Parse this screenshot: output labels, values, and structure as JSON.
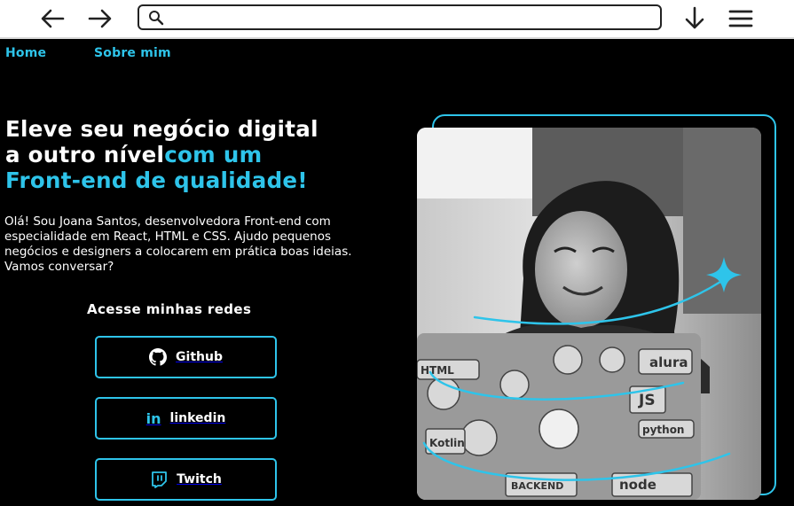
{
  "browser": {
    "url_value": "",
    "icons": [
      "back-arrow-icon",
      "forward-arrow-icon",
      "search-icon",
      "download-icon",
      "hamburger-menu-icon"
    ]
  },
  "nav": {
    "home": "Home",
    "about": "Sobre mim"
  },
  "hero": {
    "headline_white_1": "Eleve seu negócio digital",
    "headline_white_2": "a outro nível",
    "headline_accent_1": "com um",
    "headline_accent_2": "Front-end de qualidade!",
    "intro": "Olá! Sou Joana Santos, desenvolvedora Front-end com especialidade em React, HTML e CSS. Ajudo pequenos negócios e designers a colocarem em prática boas ideias. Vamos conversar?"
  },
  "social": {
    "title": "Acesse minhas redes",
    "buttons": [
      {
        "label": "Github",
        "icon": "github-icon"
      },
      {
        "label": "linkedin",
        "icon": "linkedin-icon"
      },
      {
        "label": "Twitch",
        "icon": "twitch-icon"
      }
    ]
  },
  "photo": {
    "laptop_stickers": [
      "alura",
      "JS",
      "python",
      "HTML",
      "Kotlin",
      "node",
      "BACKEND"
    ]
  },
  "colors": {
    "accent": "#2ec4ea",
    "background": "#000000",
    "text": "#ffffff"
  }
}
